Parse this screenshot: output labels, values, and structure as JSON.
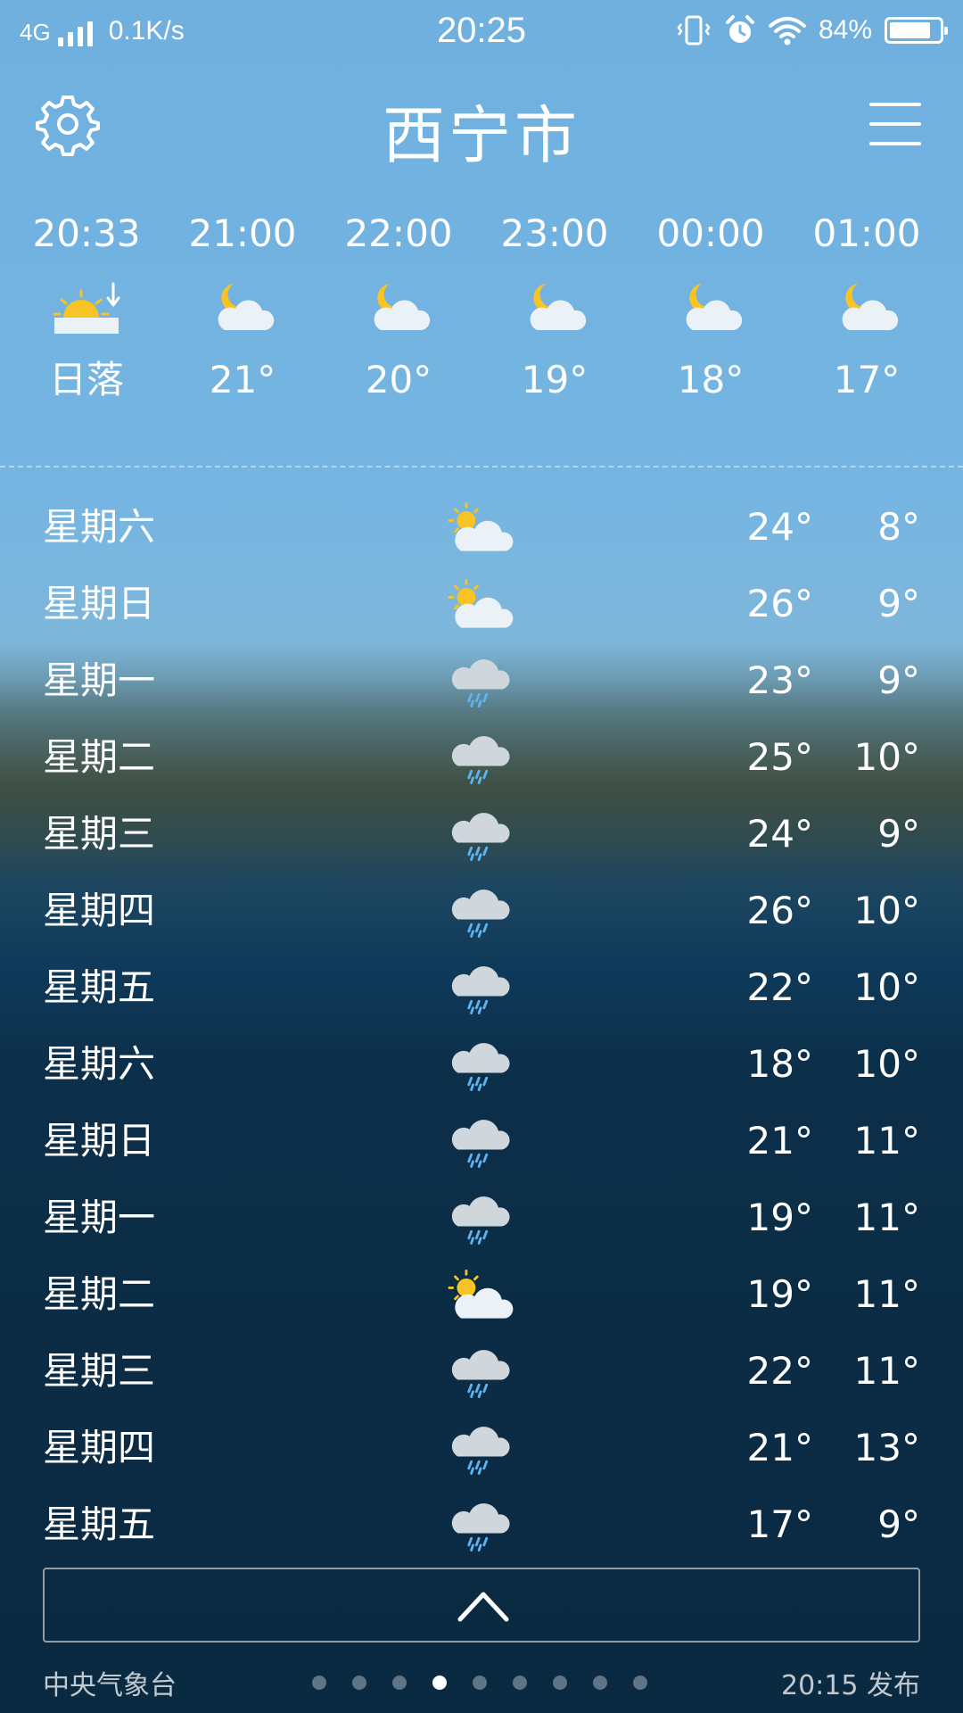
{
  "status_bar": {
    "network": "4G",
    "speed": "0.1K/s",
    "time": "20:25",
    "battery_percent": "84%",
    "battery_level": 0.84
  },
  "header": {
    "city": "西宁市"
  },
  "hourly": [
    {
      "time": "20:33",
      "icon": "sunset-icon",
      "label": "日落"
    },
    {
      "time": "21:00",
      "icon": "moon-cloud-icon",
      "label": "21°"
    },
    {
      "time": "22:00",
      "icon": "moon-cloud-icon",
      "label": "20°"
    },
    {
      "time": "23:00",
      "icon": "moon-cloud-icon",
      "label": "19°"
    },
    {
      "time": "00:00",
      "icon": "moon-cloud-icon",
      "label": "18°"
    },
    {
      "time": "01:00",
      "icon": "moon-cloud-icon",
      "label": "17°"
    }
  ],
  "daily": [
    {
      "day": "星期六",
      "icon": "partly-cloudy-icon",
      "high": "24°",
      "low": "8°"
    },
    {
      "day": "星期日",
      "icon": "partly-cloudy-icon",
      "high": "26°",
      "low": "9°"
    },
    {
      "day": "星期一",
      "icon": "rain-icon",
      "high": "23°",
      "low": "9°"
    },
    {
      "day": "星期二",
      "icon": "rain-icon",
      "high": "25°",
      "low": "10°"
    },
    {
      "day": "星期三",
      "icon": "rain-icon",
      "high": "24°",
      "low": "9°"
    },
    {
      "day": "星期四",
      "icon": "rain-icon",
      "high": "26°",
      "low": "10°"
    },
    {
      "day": "星期五",
      "icon": "rain-icon",
      "high": "22°",
      "low": "10°"
    },
    {
      "day": "星期六",
      "icon": "rain-icon",
      "high": "18°",
      "low": "10°"
    },
    {
      "day": "星期日",
      "icon": "rain-icon",
      "high": "21°",
      "low": "11°"
    },
    {
      "day": "星期一",
      "icon": "rain-icon",
      "high": "19°",
      "low": "11°"
    },
    {
      "day": "星期二",
      "icon": "partly-cloudy-icon",
      "high": "19°",
      "low": "11°"
    },
    {
      "day": "星期三",
      "icon": "rain-icon",
      "high": "22°",
      "low": "11°"
    },
    {
      "day": "星期四",
      "icon": "rain-icon",
      "high": "21°",
      "low": "13°"
    },
    {
      "day": "星期五",
      "icon": "rain-icon",
      "high": "17°",
      "low": "9°"
    }
  ],
  "footer": {
    "source": "中央气象台",
    "published": "20:15 发布",
    "page_count": 9,
    "active_page": 4
  },
  "colors": {
    "sun": "#f7c325",
    "cloud": "#eaf2f8",
    "rain_cloud": "#cfd6dc",
    "rain": "#5fb4f0"
  }
}
